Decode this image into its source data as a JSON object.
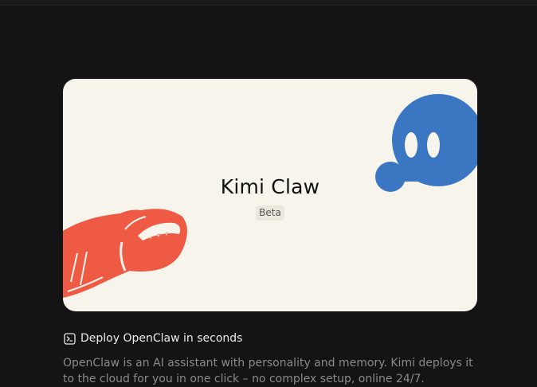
{
  "hero": {
    "title": "Kimi Claw",
    "badge": "Beta",
    "card_bg": "#f7f4ec",
    "mascot_blue": "#3a76c2",
    "mascot_red": "#ef5a45"
  },
  "section": {
    "icon": "terminal-icon",
    "title": "Deploy OpenClaw in seconds",
    "description": "OpenClaw is an AI assistant with personality and memory. Kimi deploys it to the cloud for you in one click – no complex setup, online 24/7."
  }
}
